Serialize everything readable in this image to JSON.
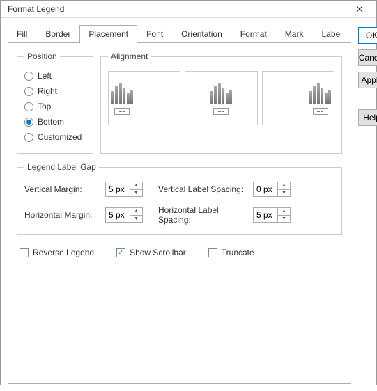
{
  "window": {
    "title": "Format Legend"
  },
  "tabs": [
    "Fill",
    "Border",
    "Placement",
    "Font",
    "Orientation",
    "Format",
    "Mark",
    "Label"
  ],
  "active_tab": "Placement",
  "position": {
    "legend": "Position",
    "options": [
      "Left",
      "Right",
      "Top",
      "Bottom",
      "Customized"
    ],
    "selected": "Bottom"
  },
  "alignment": {
    "legend": "Alignment"
  },
  "gap": {
    "legend": "Legend Label Gap",
    "vmargin_label": "Vertical Margin:",
    "vmargin_value": "5 px",
    "hmargin_label": "Horizontal Margin:",
    "hmargin_value": "5 px",
    "vspacing_label": "Vertical Label Spacing:",
    "vspacing_value": "0 px",
    "hspacing_label": "Horizontal Label Spacing:",
    "hspacing_value": "5 px"
  },
  "checks": {
    "reverse": "Reverse Legend",
    "scrollbar": "Show Scrollbar",
    "truncate": "Truncate"
  },
  "buttons": {
    "ok": "OK",
    "cancel": "Cancel",
    "apply": "Apply",
    "help": "Help"
  }
}
